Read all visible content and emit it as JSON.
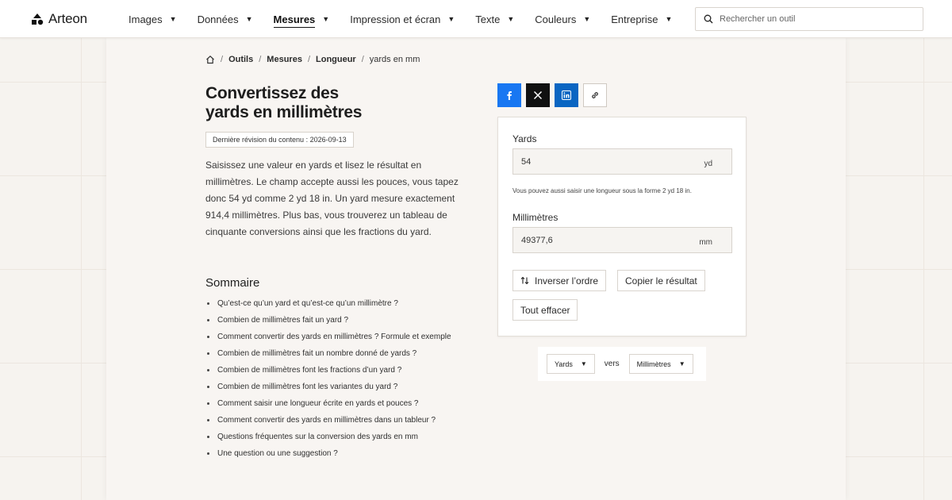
{
  "nav": {
    "logo": "Arteon",
    "menu": [
      {
        "label": "Images"
      },
      {
        "label": "Données"
      },
      {
        "label": "Mesures"
      },
      {
        "label": "Impression et écran"
      },
      {
        "label": "Texte"
      },
      {
        "label": "Couleurs"
      },
      {
        "label": "Entreprise"
      }
    ],
    "active_menu": "Mesures",
    "search_placeholder": "Rechercher un outil"
  },
  "breadcrumb": [
    "Outils",
    "Mesures",
    "Longueur",
    "yards en mm"
  ],
  "title_line1": "Convertissez des",
  "title_line2": "yards en millimètres",
  "revision": "Dernière révision du contenu : 2026-09-13",
  "intro": "Saisissez une valeur en yards et lisez le résultat en millimètres. Le champ accepte aussi les pouces, vous tapez donc 54 yd comme 2 yd 18 in. Un yard mesure exactement 914,4 millimètres. Plus bas, vous trouverez un tableau de cinquante conversions ainsi que les fractions du yard.",
  "summary": {
    "heading": "Sommaire",
    "items": [
      "Qu’est-ce qu’un yard et qu’est-ce qu’un millimètre ?",
      "Combien de millimètres fait un yard ?",
      "Comment convertir des yards en millimètres ? Formule et exemple",
      "Combien de millimètres fait un nombre donné de yards ?",
      "Combien de millimètres font les fractions d’un yard ?",
      "Combien de millimètres font les variantes du yard ?",
      "Comment saisir une longueur écrite en yards et pouces ?",
      "Comment convertir des yards en millimètres dans un tableur ?",
      "Questions fréquentes sur la conversion des yards en mm",
      "Une question ou une suggestion ?"
    ]
  },
  "share_icons": [
    "facebook-icon",
    "x-icon",
    "linkedin-icon",
    "link-icon"
  ],
  "colors": {
    "facebook": "#1877f2",
    "x": "#111111",
    "linkedin": "#0a66c2"
  },
  "converter": {
    "from_label": "Yards",
    "from_value": "54",
    "from_unit": "yd",
    "hint": "Vous pouvez aussi saisir une longueur sous la forme 2 yd 18 in.",
    "to_label": "Millimètres",
    "to_value": "49377,6",
    "to_unit": "mm",
    "swap_label": "Inverser l’ordre",
    "copy_label": "Copier le résultat",
    "clear_label": "Tout effacer"
  },
  "unit_select": {
    "from": "Yards",
    "between": "vers",
    "to": "Millimètres"
  }
}
